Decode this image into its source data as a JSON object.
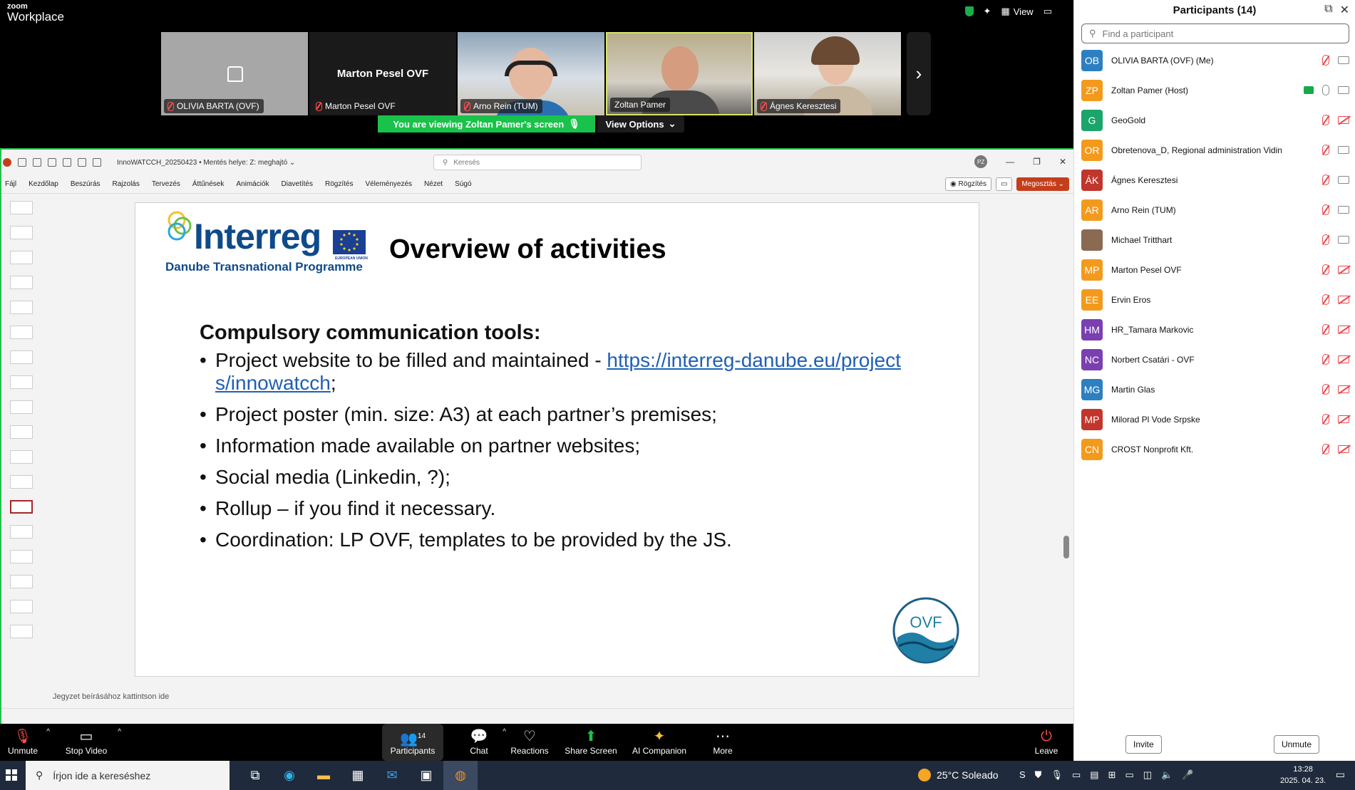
{
  "zoom": {
    "brand_line1": "zoom",
    "brand_line2": "Workplace",
    "view_label": "View",
    "videos": [
      {
        "name": "OLIVIA BARTA (OVF)"
      },
      {
        "name": "Marton Pesel OVF",
        "big_label": "Marton Pesel OVF"
      },
      {
        "name": "Arno Rein (TUM)"
      },
      {
        "name": "Zoltan Pamer"
      },
      {
        "name": "Ágnes Keresztesi"
      }
    ],
    "next_glyph": "›",
    "viewing_text": "You are viewing  Zoltan Pamer's screen",
    "view_options": "View Options",
    "toolbar": {
      "unmute": "Unmute",
      "stop_video": "Stop Video",
      "participants": "Participants",
      "participants_count": "14",
      "chat": "Chat",
      "reactions": "Reactions",
      "share_screen": "Share Screen",
      "ai_companion": "AI Companion",
      "more": "More",
      "leave": "Leave"
    }
  },
  "ppt": {
    "doc_title": "InnoWATCCH_20250423 • Mentés helye: Z: meghajtó ⌄",
    "search_placeholder": "Keresés",
    "user_initials": "PZ",
    "tabs": [
      "Fájl",
      "Kezdőlap",
      "Beszúrás",
      "Rajzolás",
      "Tervezés",
      "Áttűnések",
      "Animációk",
      "Diavetítés",
      "Rögzítés",
      "Véleményezés",
      "Nézet",
      "Súgó"
    ],
    "record_btn": "Rögzítés",
    "share_btn": "Megosztás",
    "notes_placeholder": "Jegyzet beírásához kattintson ide",
    "slide": {
      "logo_word": "Interreg",
      "logo_sub": "Danube Transnational Programme",
      "eu_label": "EUROPEAN UNION",
      "title": "Overview of activities",
      "heading": "Compulsory communication tools:",
      "bullet1_prefix": "Project website to be filled and maintained - ",
      "bullet1_link": "https://interreg-danube.eu/projects/innowatcch",
      "bullet1_suffix": ";",
      "bullet2": "Project poster (min. size: A3) at each partner’s premises;",
      "bullet3": "Information made available on partner websites;",
      "bullet4": "Social media (Linkedin, ?);",
      "bullet5": "Rollup – if you find it necessary.",
      "bullet6": "Coordination: LP OVF, templates to be provided by the JS.",
      "ovf_logo": "OVF"
    }
  },
  "participants": {
    "title": "Participants (14)",
    "search_placeholder": "Find a participant",
    "items": [
      {
        "initials": "OB",
        "name": "OLIVIA BARTA (OVF) (Me)",
        "color": "#2d7fc1",
        "mic": "off",
        "cam": "on"
      },
      {
        "initials": "ZP",
        "name": "Zoltan Pamer (Host)",
        "color": "#f39a1c",
        "mic": "on",
        "cam": "on",
        "sharing": true
      },
      {
        "initials": "G",
        "name": "GeoGold",
        "color": "#1aa56a",
        "mic": "off",
        "cam": "off"
      },
      {
        "initials": "OR",
        "name": "Obretenova_D, Regional administration Vidin",
        "color": "#f39a1c",
        "mic": "off",
        "cam": "on"
      },
      {
        "initials": "ÁK",
        "name": "Ágnes Keresztesi",
        "color": "#c1362c",
        "mic": "off",
        "cam": "on"
      },
      {
        "initials": "AR",
        "name": "Arno Rein (TUM)",
        "color": "#f39a1c",
        "mic": "off",
        "cam": "on"
      },
      {
        "initials": "",
        "name": "Michael Tritthart",
        "color": "#8a6a52",
        "mic": "off",
        "cam": "on"
      },
      {
        "initials": "MP",
        "name": "Marton Pesel OVF",
        "color": "#f39a1c",
        "mic": "off",
        "cam": "off"
      },
      {
        "initials": "EE",
        "name": "Ervin Eros",
        "color": "#f39a1c",
        "mic": "off",
        "cam": "off"
      },
      {
        "initials": "HM",
        "name": "HR_Tamara Markovic",
        "color": "#7a3fb0",
        "mic": "off",
        "cam": "off"
      },
      {
        "initials": "NC",
        "name": "Norbert Csatári - OVF",
        "color": "#7a3fb0",
        "mic": "off",
        "cam": "off"
      },
      {
        "initials": "MG",
        "name": "Martin Glas",
        "color": "#2d7fc1",
        "mic": "off",
        "cam": "off"
      },
      {
        "initials": "MP",
        "name": "Milorad Pl Vode Srpske",
        "color": "#c1362c",
        "mic": "off",
        "cam": "off"
      },
      {
        "initials": "CN",
        "name": "CROST Nonprofit Kft.",
        "color": "#f39a1c",
        "mic": "off",
        "cam": "off"
      }
    ],
    "invite": "Invite",
    "unmute": "Unmute"
  },
  "taskbar": {
    "search_placeholder": "Írjon ide a kereséshez",
    "weather": "25°C  Soleado",
    "time": "13:28",
    "date": "2025. 04. 23."
  }
}
